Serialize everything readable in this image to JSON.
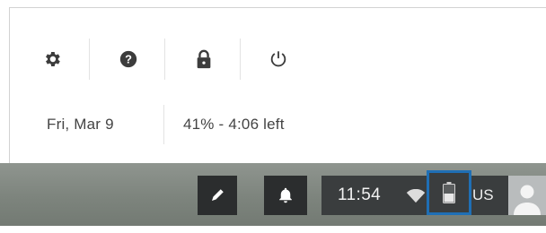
{
  "quick_settings": {
    "icons": [
      {
        "name": "settings-gear-icon",
        "label": "Settings"
      },
      {
        "name": "help-question-icon",
        "label": "Help"
      },
      {
        "name": "lock-icon",
        "label": "Lock"
      },
      {
        "name": "power-icon",
        "label": "Power"
      }
    ],
    "date": "Fri, Mar 9",
    "battery": "41% - 4:06 left"
  },
  "shelf": {
    "time": "11:54",
    "ime": "US"
  },
  "colors": {
    "shelf_bg": "#7d847d",
    "status_area_bg": "#3a3d3e",
    "highlight_border": "#1f6fb5",
    "icon_color": "#3c3c3c"
  }
}
